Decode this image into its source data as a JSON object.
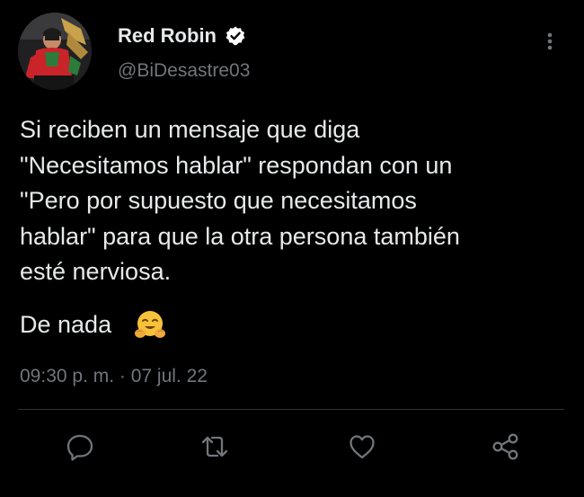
{
  "tweet": {
    "display_name": "Red Robin",
    "handle": "@BiDesastre03",
    "body_lines": [
      "Si reciben un mensaje que diga",
      "\"Necesitamos hablar\" respondan con un",
      "\"Pero por supuesto que necesitamos",
      "hablar\" para que la otra persona también",
      "esté nerviosa."
    ],
    "closing": "De nada",
    "closing_emoji": "hugging-face-icon",
    "timestamp": "09:30 p. m. · 07 jul. 22"
  },
  "icons": {
    "verified": "verified-badge-icon",
    "more": "more-vertical-icon",
    "reply": "reply-icon",
    "retweet": "retweet-icon",
    "like": "heart-icon",
    "share": "share-icon"
  },
  "colors": {
    "background": "#000000",
    "primary_text": "#e7e9ea",
    "secondary_text": "#71767b",
    "divider": "#2f3336",
    "verified_badge": "#ffffff",
    "emoji_yellow": "#f7c23a"
  }
}
